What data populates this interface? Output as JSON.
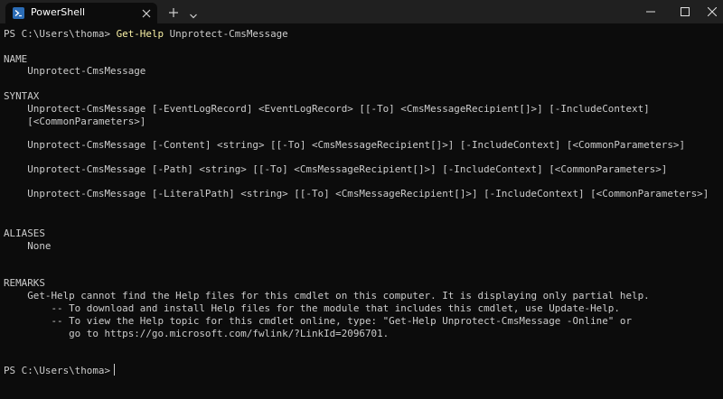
{
  "tab": {
    "title": "PowerShell",
    "icon": "powershell-icon",
    "close_icon": "close-icon"
  },
  "titlebar": {
    "new_tab_icon": "plus-icon",
    "dropdown_icon": "chevron-down-icon",
    "minimize_icon": "minimize-icon",
    "maximize_icon": "maximize-icon",
    "close_icon": "close-icon"
  },
  "terminal": {
    "prompt_1": "PS C:\\Users\\thoma> ",
    "command_name": "Get-Help",
    "command_arg": " Unprotect-CmsMessage",
    "name_header": "NAME",
    "name_value": "    Unprotect-CmsMessage",
    "syntax_header": "SYNTAX",
    "syntax_1a": "    Unprotect-CmsMessage [-EventLogRecord] <EventLogRecord> [[-To] <CmsMessageRecipient[]>] [-IncludeContext]",
    "syntax_1b": "    [<CommonParameters>]",
    "syntax_2": "    Unprotect-CmsMessage [-Content] <string> [[-To] <CmsMessageRecipient[]>] [-IncludeContext] [<CommonParameters>]",
    "syntax_3": "    Unprotect-CmsMessage [-Path] <string> [[-To] <CmsMessageRecipient[]>] [-IncludeContext] [<CommonParameters>]",
    "syntax_4": "    Unprotect-CmsMessage [-LiteralPath] <string> [[-To] <CmsMessageRecipient[]>] [-IncludeContext] [<CommonParameters>]",
    "aliases_header": "ALIASES",
    "aliases_value": "    None",
    "remarks_header": "REMARKS",
    "remarks_1": "    Get-Help cannot find the Help files for this cmdlet on this computer. It is displaying only partial help.",
    "remarks_2": "        -- To download and install Help files for the module that includes this cmdlet, use Update-Help.",
    "remarks_3": "        -- To view the Help topic for this cmdlet online, type: \"Get-Help Unprotect-CmsMessage -Online\" or",
    "remarks_4": "           go to https://go.microsoft.com/fwlink/?LinkId=2096701.",
    "prompt_2": "PS C:\\Users\\thoma>"
  },
  "colors": {
    "background": "#0c0c0c",
    "text": "#cccccc",
    "command": "#f9f1a5",
    "titlebar": "#202020"
  }
}
